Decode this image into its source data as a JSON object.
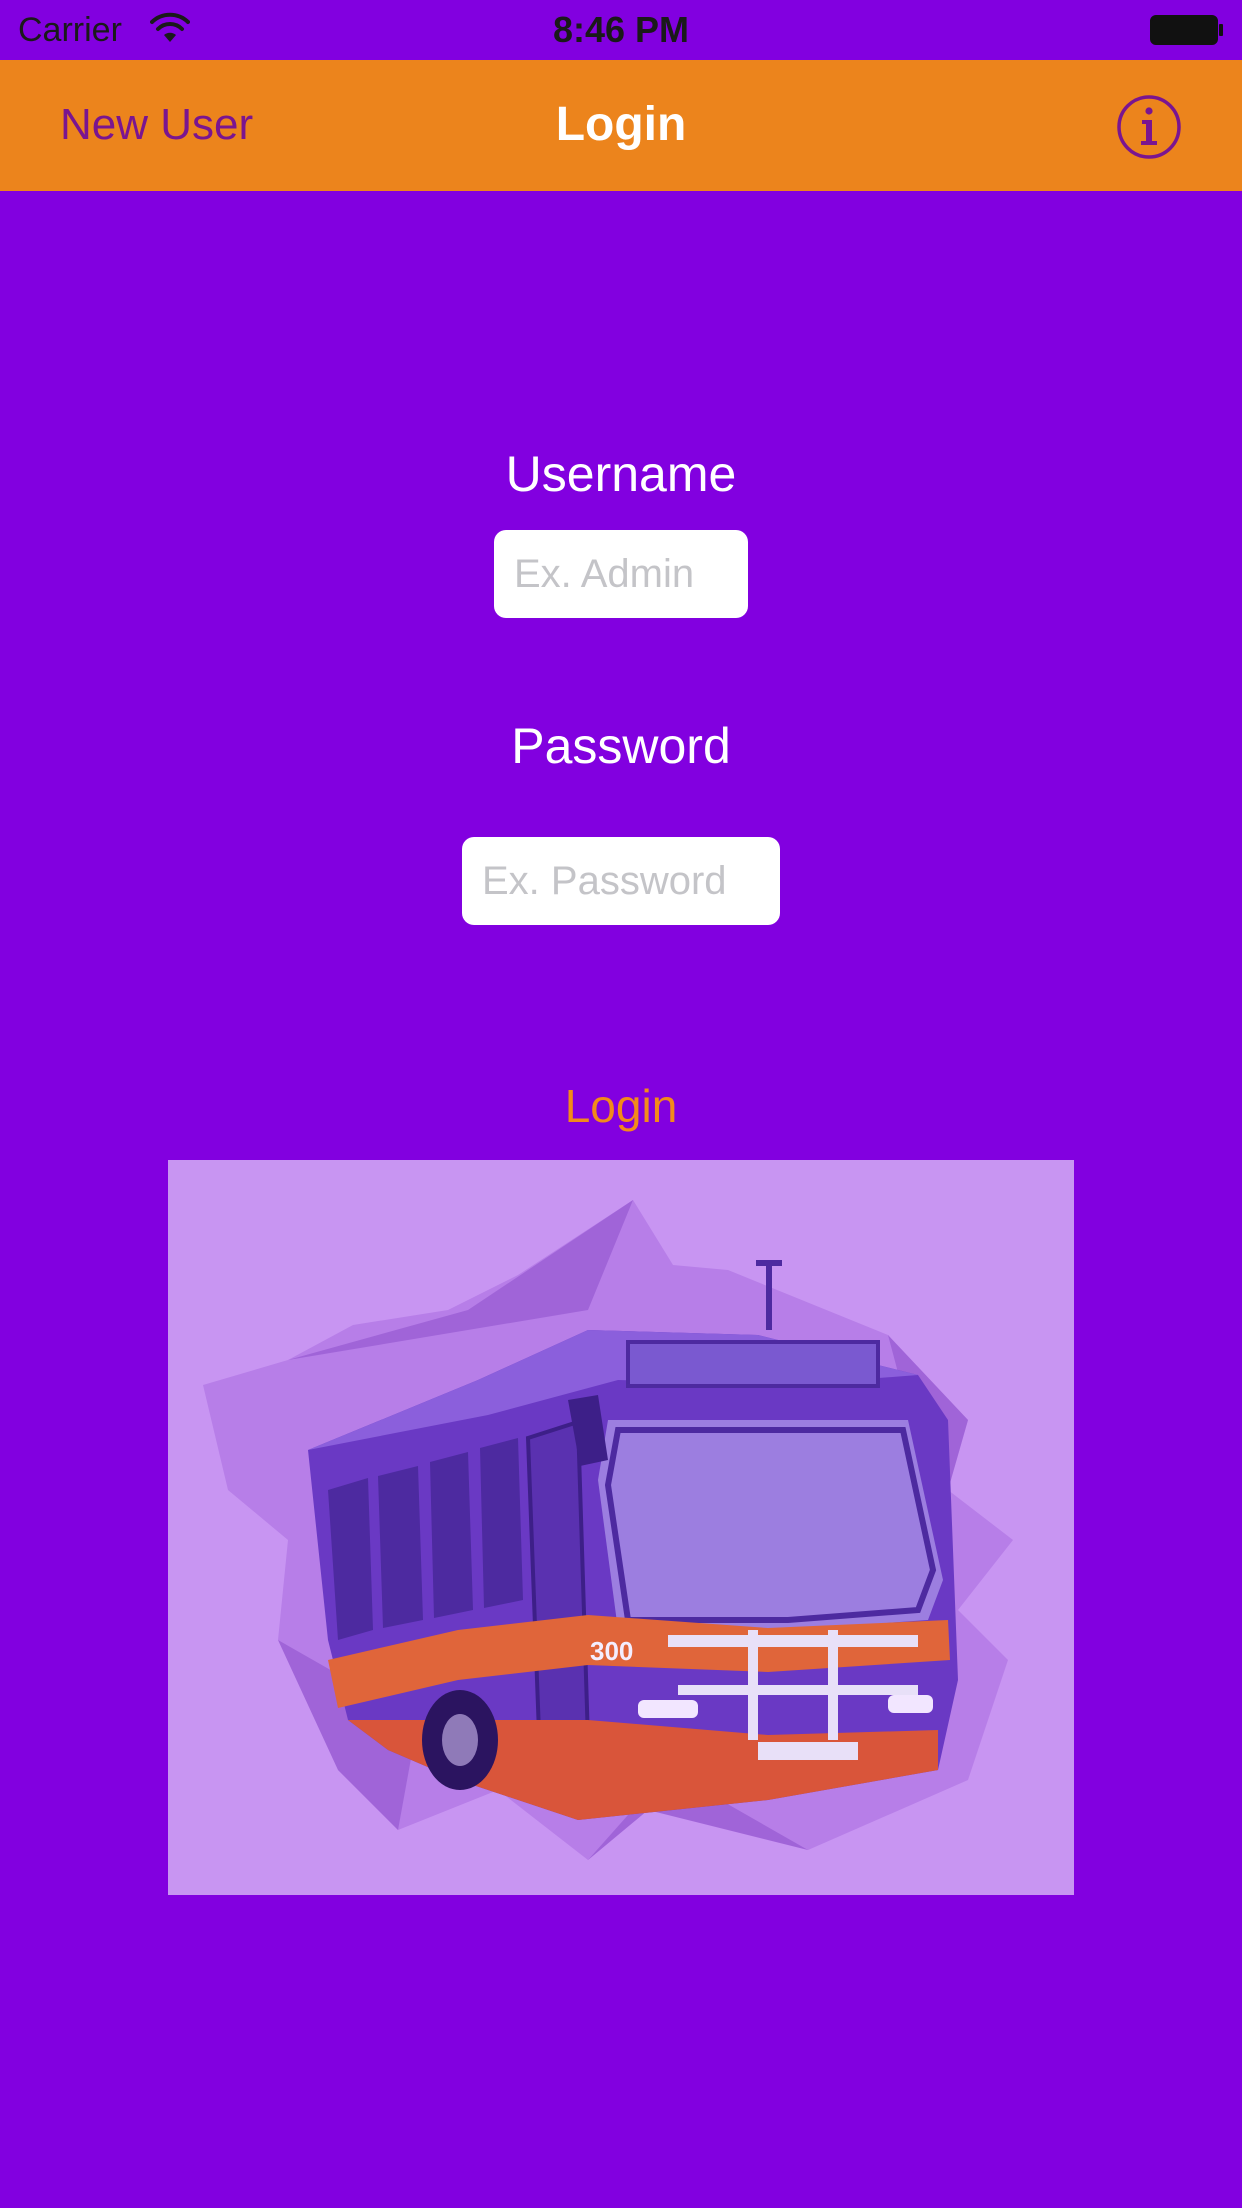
{
  "status_bar": {
    "carrier": "Carrier",
    "time": "8:46 PM",
    "icons": [
      "wifi-icon",
      "battery-icon"
    ]
  },
  "nav_bar": {
    "left_button": "New User",
    "title": "Login",
    "right_icon": "info-icon",
    "background_color": "#ec841c"
  },
  "form": {
    "username_label": "Username",
    "username_placeholder": "Ex. Admin",
    "username_value": "",
    "password_label": "Password",
    "password_placeholder": "Ex. Password",
    "password_value": "",
    "login_button": "Login"
  },
  "image": {
    "bus_number": "300",
    "description_icon": "bus-illustration"
  },
  "colors": {
    "background": "#8200e0",
    "accent": "#f28a1a",
    "nav_text": "#7a1590"
  }
}
